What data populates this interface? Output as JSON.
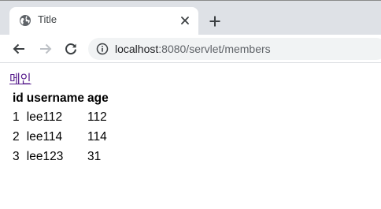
{
  "browser": {
    "tab": {
      "title": "Title",
      "favicon": "globe-icon",
      "close_icon": "close-icon"
    },
    "new_tab_icon": "plus-icon",
    "toolbar": {
      "back_icon": "arrow-left-icon",
      "forward_icon": "arrow-right-icon",
      "reload_icon": "reload-icon",
      "site_info_icon": "info-icon"
    },
    "url": {
      "host": "localhost",
      "rest": ":8080/servlet/members"
    }
  },
  "page": {
    "main_link": "메인",
    "link_color": "#551a8b",
    "table": {
      "headers": [
        "id",
        "username",
        "age"
      ],
      "rows": [
        [
          "1",
          "lee112",
          "112"
        ],
        [
          "2",
          "lee114",
          "114"
        ],
        [
          "3",
          "lee123",
          "31"
        ]
      ]
    }
  }
}
